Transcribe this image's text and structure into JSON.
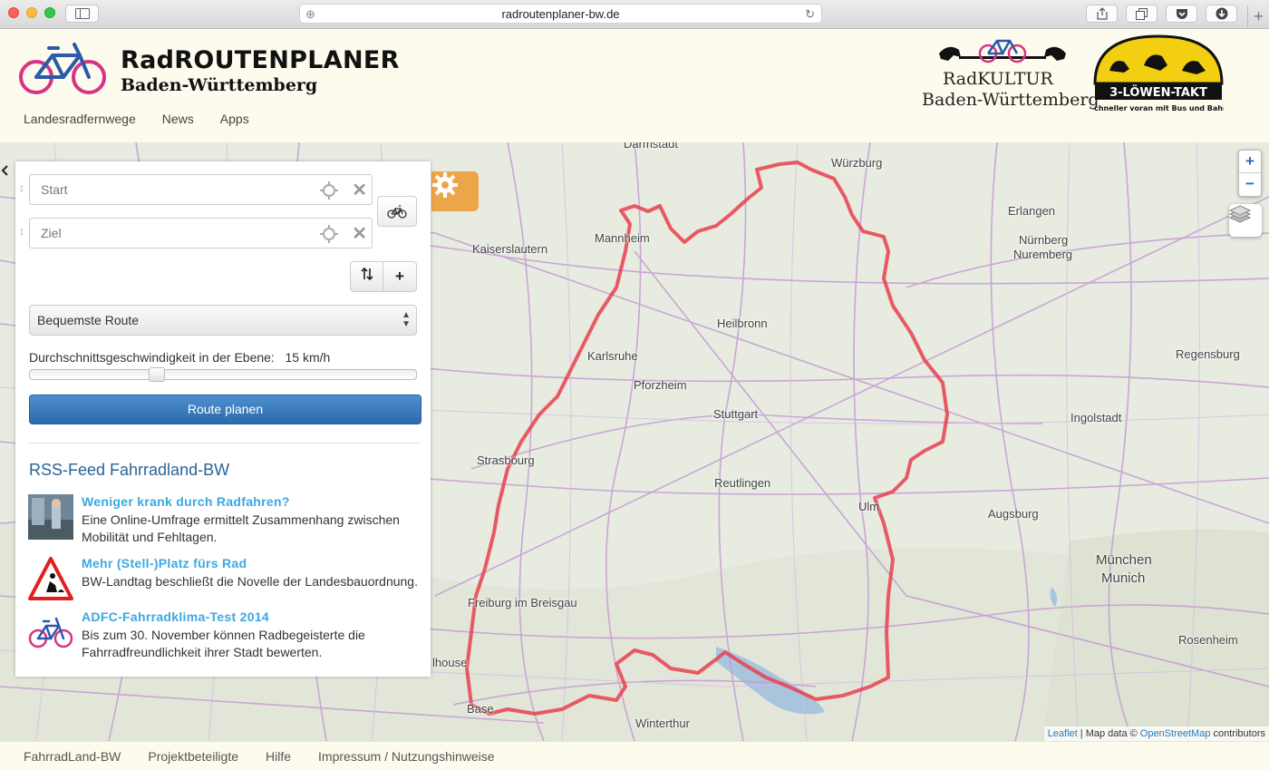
{
  "browser": {
    "url": "radroutenplaner-bw.de"
  },
  "header": {
    "title": "RadROUTENPLANER",
    "subtitle": "Baden-Württemberg",
    "nav": [
      "Landesradfernwege",
      "News",
      "Apps"
    ],
    "partner1_line1": "RadKULTUR",
    "partner1_line2": "Baden-Württemberg",
    "partner2_title": "3-LÖWEN-TAKT",
    "partner2_tagline": "Schneller voran mit Bus und Bahn"
  },
  "planner": {
    "start_placeholder": "Start",
    "ziel_placeholder": "Ziel",
    "route_option": "Bequemste Route",
    "speed_label": "Durchschnittsgeschwindigkeit in der Ebene:",
    "speed_value": "15 km/h",
    "speed_slider_fraction": 0.32,
    "plan_button": "Route planen"
  },
  "rss": {
    "title": "RSS-Feed Fahrradland-BW",
    "items": [
      {
        "title": "Weniger krank durch Radfahren?",
        "desc": "Eine Online-Umfrage ermittelt Zusammenhang zwischen Mobilität und Fehltagen."
      },
      {
        "title": "Mehr (Stell-)Platz fürs Rad",
        "desc": "BW-Landtag beschließt die Novelle der Landesbauordnung."
      },
      {
        "title": "ADFC-Fahrradklima-Test 2014",
        "desc": "Bis zum 30. November können Radbegeisterte die Fahrradfreundlichkeit ihrer Stadt bewerten."
      }
    ]
  },
  "map": {
    "cities": [
      "Darmstadt",
      "Würzburg",
      "Erlangen",
      "Nürnberg",
      "Nuremberg",
      "Kaiserslautern",
      "Mannheim",
      "Heilbronn",
      "Regensburg",
      "Karlsruhe",
      "Pforzheim",
      "Stuttgart",
      "Ingolstadt",
      "Strasbourg",
      "Reutlingen",
      "Ulm",
      "Augsburg",
      "München",
      "Munich",
      "Freiburg im Breisgau",
      "Rosenheim",
      "lhouse",
      "Base",
      "Winterthur"
    ],
    "zoom_in": "+",
    "zoom_out": "−",
    "attribution_leaflet": "Leaflet",
    "attribution_mid": "| Map data ©",
    "attribution_osm": "OpenStreetMap",
    "attribution_end": "contributors",
    "border_color": "#e8404f"
  },
  "footer": {
    "links": [
      "FahrradLand-BW",
      "Projektbeteiligte",
      "Hilfe",
      "Impressum / Nutzungshinweise"
    ]
  }
}
